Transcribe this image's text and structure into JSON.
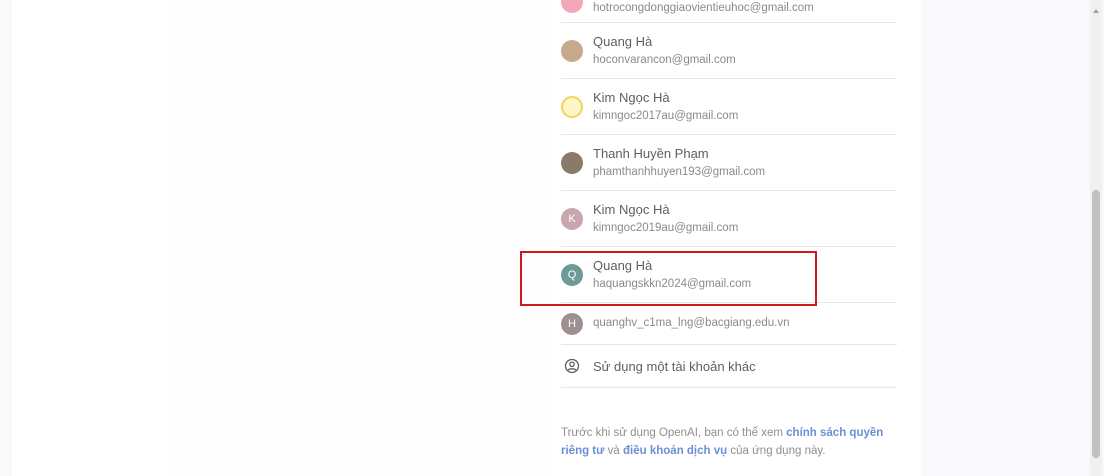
{
  "accounts": [
    {
      "name": "",
      "email": "hotrocongdonggiaovientieuhoc@gmail.com",
      "avatar_color": "#f4a7b9",
      "initial": ""
    },
    {
      "name": "Quang Hà",
      "email": "hoconvarancon@gmail.com",
      "avatar_color": "#c9a98c",
      "initial": ""
    },
    {
      "name": "Kim Ngọc Hà",
      "email": "kimngoc2017au@gmail.com",
      "avatar_color": "#f3d35a",
      "initial": ""
    },
    {
      "name": "Thanh Huyền Phạm",
      "email": "phamthanhhuyen193@gmail.com",
      "avatar_color": "#8a7a6a",
      "initial": ""
    },
    {
      "name": "Kim Ngọc Hà",
      "email": "kimngoc2019au@gmail.com",
      "avatar_color": "#c8a6ad",
      "initial": "K"
    },
    {
      "name": "Quang Hà",
      "email": "haquangskkn2024@gmail.com",
      "avatar_color": "#6c9a99",
      "initial": "Q"
    },
    {
      "name": "",
      "email": "quanghv_c1ma_lng@bacgiang.edu.vn",
      "avatar_color": "#a08f8f",
      "initial": "H"
    }
  ],
  "other_account": {
    "label": "Sử dụng một tài khoản khác",
    "icon": "account-circle-icon"
  },
  "footer": {
    "text_before": "Trước khi sử dụng OpenAI, bạn có thể xem ",
    "link_privacy": "chính sách quyền riêng tư",
    "text_and": " và ",
    "link_terms": "điều khoản dịch vụ",
    "text_after": " của ứng dụng này."
  },
  "colors": {
    "highlight_box": "#d0191f",
    "link": "#6b8fd6"
  }
}
